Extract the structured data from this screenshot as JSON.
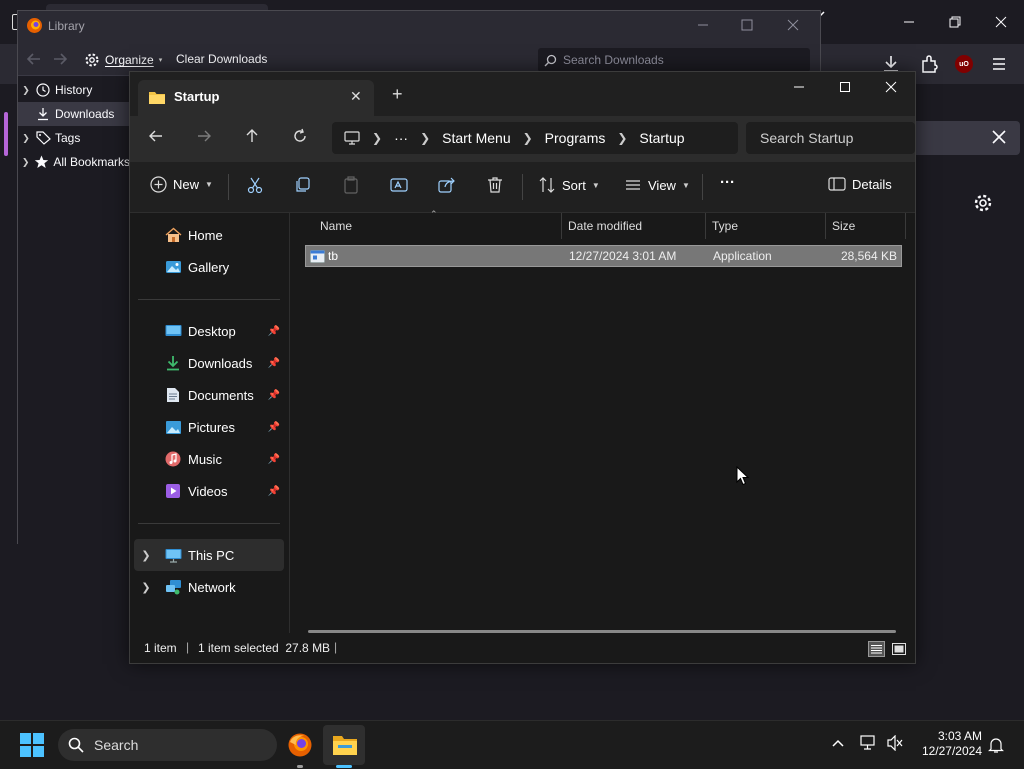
{
  "firefox": {
    "urlbar_close": "✕"
  },
  "library": {
    "title": "Library",
    "organize_label": "Organize",
    "clear_downloads_label": "Clear Downloads",
    "search_placeholder": "Search Downloads",
    "tree": [
      {
        "label": "History",
        "icon": "clock-icon"
      },
      {
        "label": "Downloads",
        "icon": "download-icon",
        "selected": true
      },
      {
        "label": "Tags",
        "icon": "tag-icon"
      },
      {
        "label": "All Bookmarks",
        "icon": "star-icon"
      }
    ]
  },
  "explorer": {
    "tab_title": "Startup",
    "breadcrumb": {
      "more": "···",
      "items": [
        "Start Menu",
        "Programs",
        "Startup"
      ]
    },
    "search_placeholder": "Search Startup",
    "commands": {
      "new": "New",
      "sort": "Sort",
      "view": "View",
      "more": "···",
      "details": "Details"
    },
    "nav": {
      "home": "Home",
      "gallery": "Gallery",
      "quick_access": [
        {
          "label": "Desktop",
          "icon": "desktop-icon"
        },
        {
          "label": "Downloads",
          "icon": "download-icon"
        },
        {
          "label": "Documents",
          "icon": "document-icon"
        },
        {
          "label": "Pictures",
          "icon": "picture-icon"
        },
        {
          "label": "Music",
          "icon": "music-icon"
        },
        {
          "label": "Videos",
          "icon": "video-icon"
        }
      ],
      "this_pc": "This PC",
      "network": "Network"
    },
    "columns": [
      "Name",
      "Date modified",
      "Type",
      "Size"
    ],
    "files": [
      {
        "name": "tb",
        "date": "12/27/2024 3:01 AM",
        "type": "Application",
        "size": "28,564 KB"
      }
    ],
    "status": {
      "count": "1 item",
      "sep": "|",
      "selected": "1 item selected  27.8 MB"
    }
  },
  "taskbar": {
    "search_label": "Search",
    "time": "3:03 AM",
    "date": "12/27/2024"
  },
  "colors": {
    "accent": "#4cc2ff",
    "folder": "#f3c447",
    "selection": "#777777",
    "firefox_surface": "#2b2a33"
  }
}
